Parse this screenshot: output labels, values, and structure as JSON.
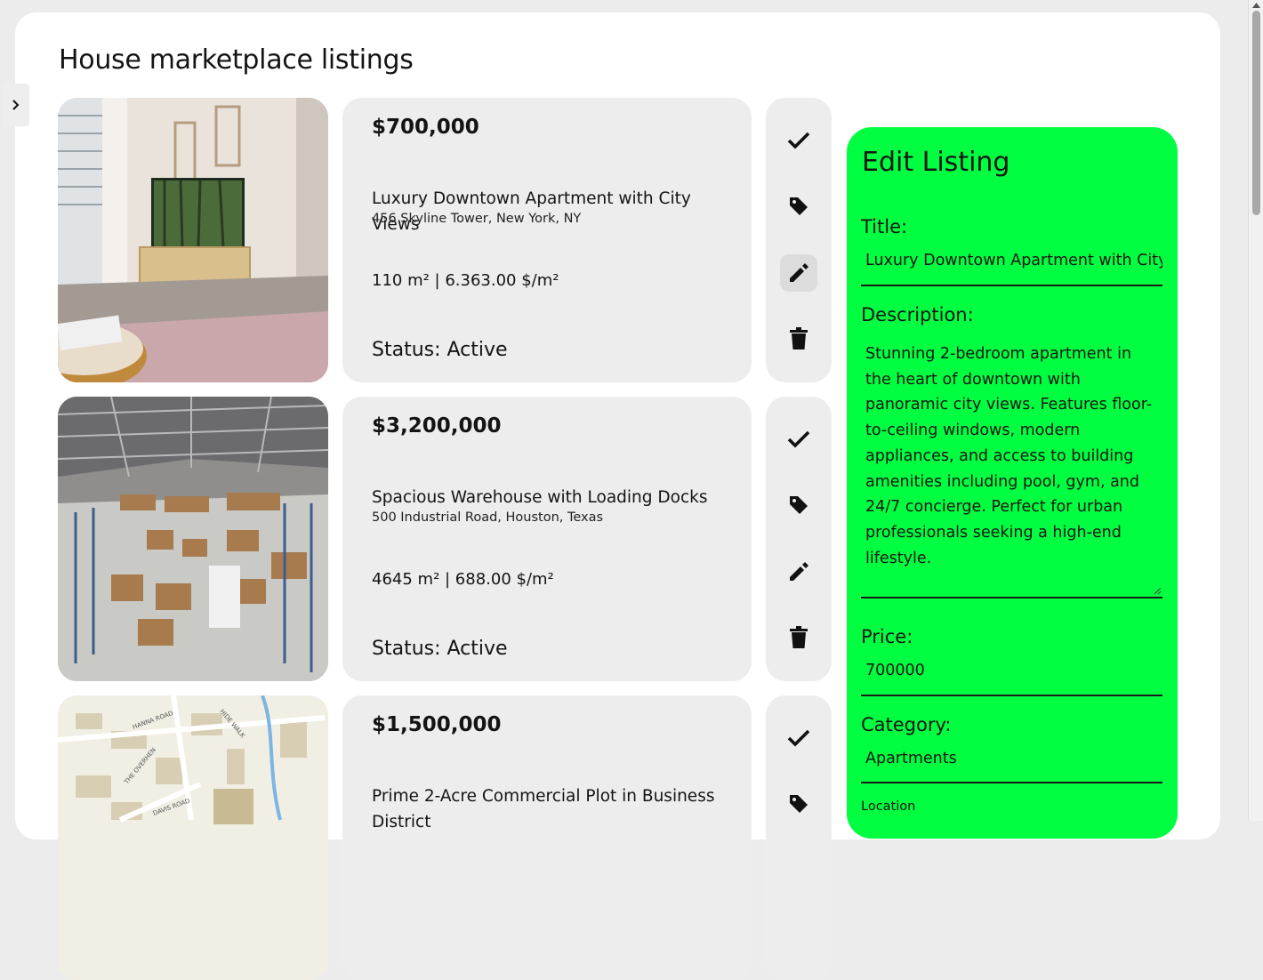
{
  "page": {
    "title": "House marketplace listings"
  },
  "listings": [
    {
      "price": "$700,000",
      "title": "Luxury Downtown Apartment with City Views",
      "address": "456 Skyline Tower, New York, NY",
      "area": "110 m² | 6.363.00 $/m²",
      "status": "Status: Active",
      "image": "apartment-living-room-photo"
    },
    {
      "price": "$3,200,000",
      "title": "Spacious Warehouse with Loading Docks",
      "address": "500 Industrial Road, Houston, Texas",
      "area": "4645 m² | 688.00 $/m²",
      "status": "Status: Active",
      "image": "warehouse-interior-photo"
    },
    {
      "price": "$1,500,000",
      "title": "Prime 2-Acre Commercial Plot in Business District",
      "image": "street-map-image",
      "map_labels": [
        "HANNA ROAD",
        "THE OVERHEN",
        "DAVIS ROAD",
        "HIDE WALK"
      ]
    }
  ],
  "actions": [
    "checkmark-icon",
    "tag-icon",
    "pencil-icon",
    "trash-icon"
  ],
  "edit_form": {
    "heading": "Edit Listing",
    "title_label": "Title:",
    "title_value": "Luxury Downtown Apartment with City Views",
    "description_label": "Description:",
    "description_value": "Stunning 2-bedroom apartment in the heart of downtown with panoramic city views. Features floor-to-ceiling windows, modern appliances, and access to building amenities including pool, gym, and 24/7 concierge. Perfect for urban professionals seeking a high-end lifestyle.",
    "price_label": "Price:",
    "price_value": "700000",
    "category_label": "Category:",
    "category_value": "Apartments",
    "location_label": "Location"
  },
  "colors": {
    "edit_panel_bg": "#00ff40",
    "card_bg": "#ededed",
    "page_bg": "#ececec"
  }
}
